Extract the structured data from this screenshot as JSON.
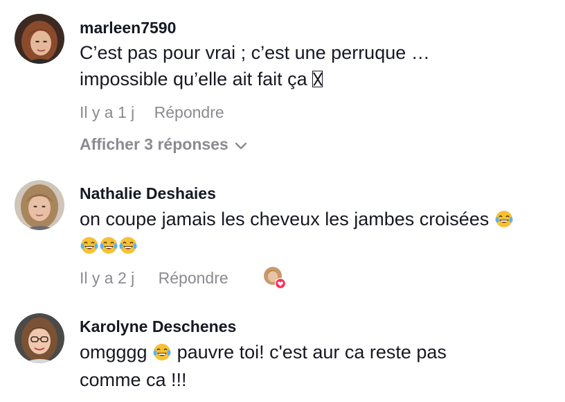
{
  "comments": [
    {
      "username": "marleen7590",
      "text_line1": "C’est pas pour vrai ; c’est une perruque …",
      "text_line2": "impossible qu’elle ait fait ça ",
      "age": "Il y a 1 j",
      "reply_label": "Répondre",
      "view_replies_label": "Afficher 3 réponses",
      "avatar_icon": "woman-reddish-hair-avatar"
    },
    {
      "username": "Nathalie Deshaies",
      "text_line1": "on coupe jamais les cheveux les jambes croisées ",
      "age": "Il y a 2 j",
      "reply_label": "Répondre",
      "avatar_icon": "woman-blonde-hair-avatar",
      "liked_by_creator_icon": "creator-liked-heart-icon"
    },
    {
      "username": "Karolyne Deschenes",
      "text_line1": "omgggg ",
      "text_line1_after_emoji": " pauvre toi! c'est aur ca reste pas",
      "text_line2": "comme ca !!!",
      "avatar_icon": "woman-glasses-avatar"
    }
  ],
  "colors": {
    "primary_text": "#161823",
    "secondary_text": "#8a8b91",
    "heart": "#fe2c55",
    "emoji_face": "#f6c135"
  }
}
